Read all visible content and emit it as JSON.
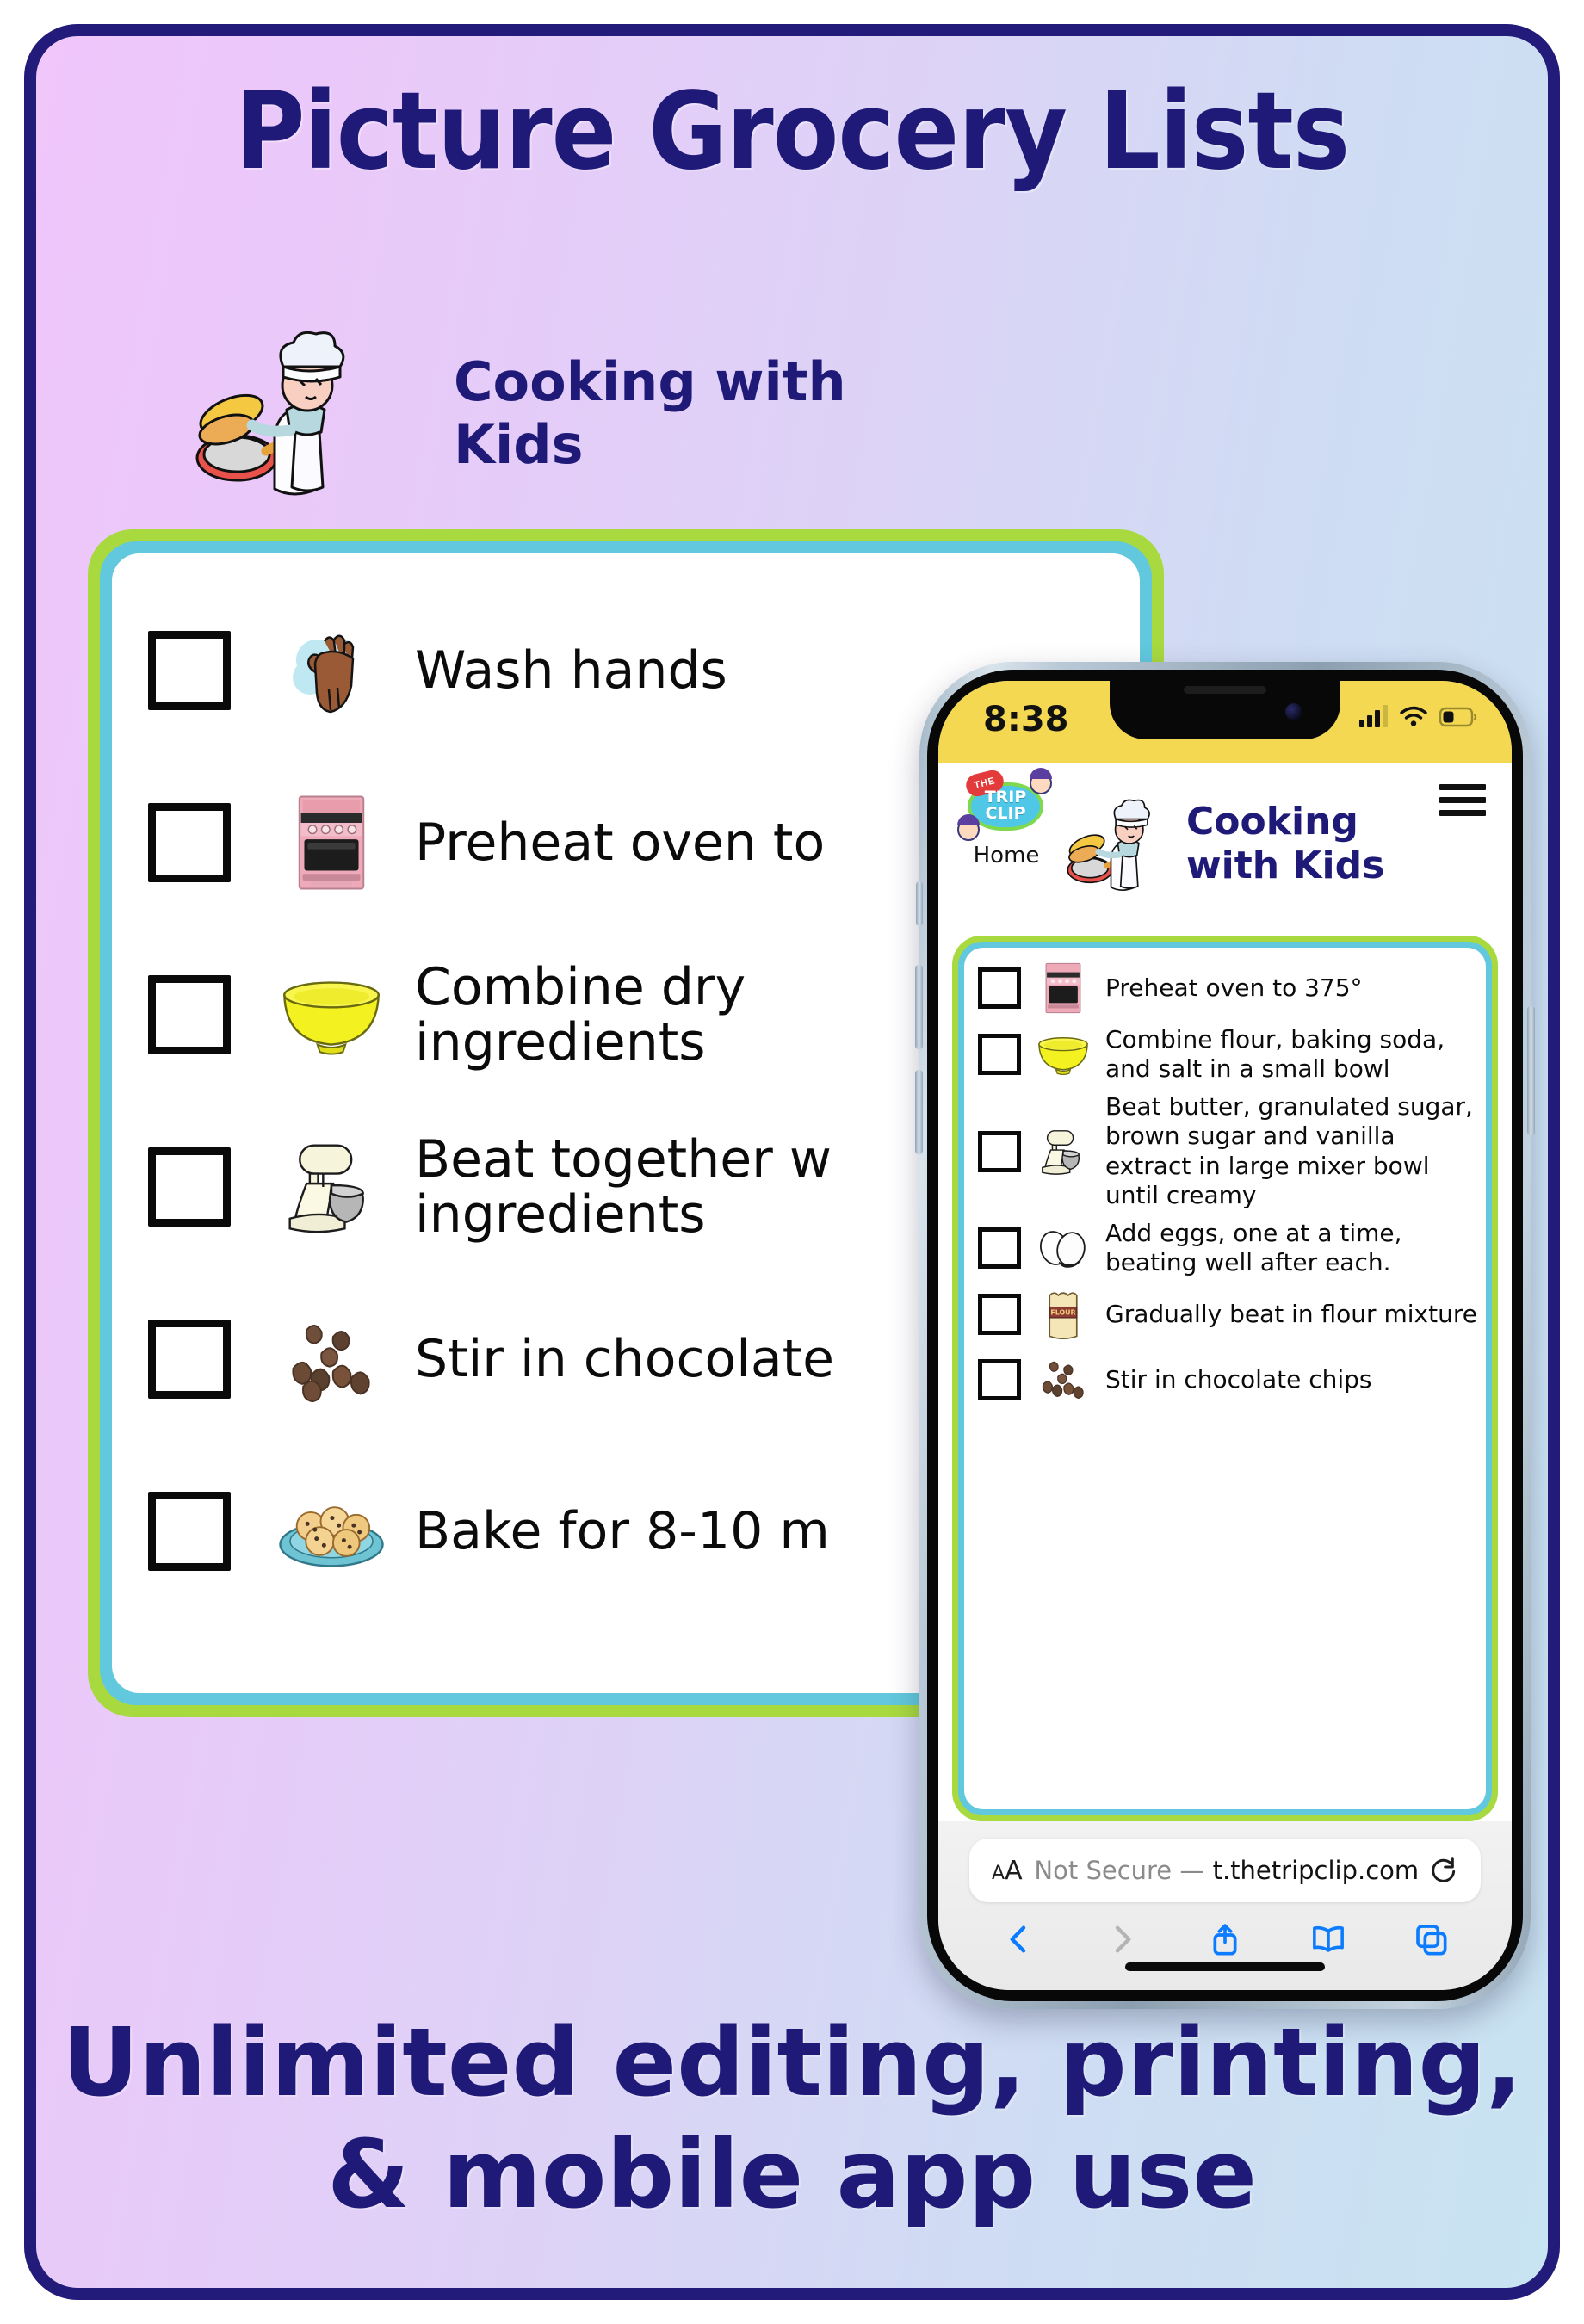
{
  "headline": "Picture Grocery Lists",
  "footer": {
    "line1": "Unlimited editing, printing,",
    "line2": "& mobile app use"
  },
  "printed_list": {
    "title": "Cooking with Kids",
    "chef_icon": "chef-cooking-icon",
    "items": [
      {
        "icon": "washing-hands-icon",
        "label": "Wash hands"
      },
      {
        "icon": "oven-icon",
        "label": "Preheat oven to"
      },
      {
        "icon": "yellow-bowl-icon",
        "label": "Combine dry\ningredients"
      },
      {
        "icon": "stand-mixer-icon",
        "label": "Beat together w\ningredients"
      },
      {
        "icon": "chocolate-chips-icon",
        "label": "Stir in chocolate"
      },
      {
        "icon": "cookies-plate-icon",
        "label": "Bake for 8-10 m"
      }
    ]
  },
  "phone": {
    "status_bar": {
      "time": "8:38",
      "signal_icon": "cellular-signal-icon",
      "wifi_icon": "wifi-icon",
      "battery_icon": "battery-icon",
      "signal_bars_filled": 3,
      "signal_bars_total": 4,
      "battery_level_percent": 32,
      "background_color": "#f5d851"
    },
    "app_header": {
      "logo_the": "THE",
      "logo_line1": "TRIP",
      "logo_line2": "CLIP",
      "logo_icon": "trip-clip-logo",
      "home_label": "Home",
      "chef_icon": "chef-cooking-icon",
      "title_line1": "Cooking",
      "title_line2": "with Kids",
      "menu_icon": "hamburger-menu-icon"
    },
    "checklist": [
      {
        "icon": "oven-icon",
        "label": "Preheat oven to 375°"
      },
      {
        "icon": "yellow-bowl-icon",
        "label": "Combine flour, baking soda, and salt in a small bowl"
      },
      {
        "icon": "stand-mixer-icon",
        "label": "Beat butter, granulated sugar, brown sugar and vanilla extract in large mixer bowl until creamy"
      },
      {
        "icon": "eggs-icon",
        "label": "Add eggs, one at a time, beating well after each."
      },
      {
        "icon": "flour-bag-icon",
        "label": "Gradually beat in flour mixture"
      },
      {
        "icon": "chocolate-chips-icon",
        "label": "Stir in chocolate chips"
      }
    ],
    "browser": {
      "text_size_icon": "aa-text-size-icon",
      "text_size_small": "A",
      "text_size_large": "A",
      "security_label": "Not Secure —",
      "domain": "t.thetripclip.com",
      "reload_icon": "reload-icon",
      "back_icon": "back-chevron-icon",
      "forward_icon": "forward-chevron-icon",
      "share_icon": "share-icon",
      "bookmarks_icon": "book-bookmarks-icon",
      "tabs_icon": "tabs-icon"
    }
  },
  "colors": {
    "navy": "#1f1a78",
    "border_navy": "#221b7a",
    "green_border": "#a8d93f",
    "cyan_border": "#62c8dd",
    "status_yellow": "#f5d851",
    "safari_blue": "#0b7bff"
  }
}
